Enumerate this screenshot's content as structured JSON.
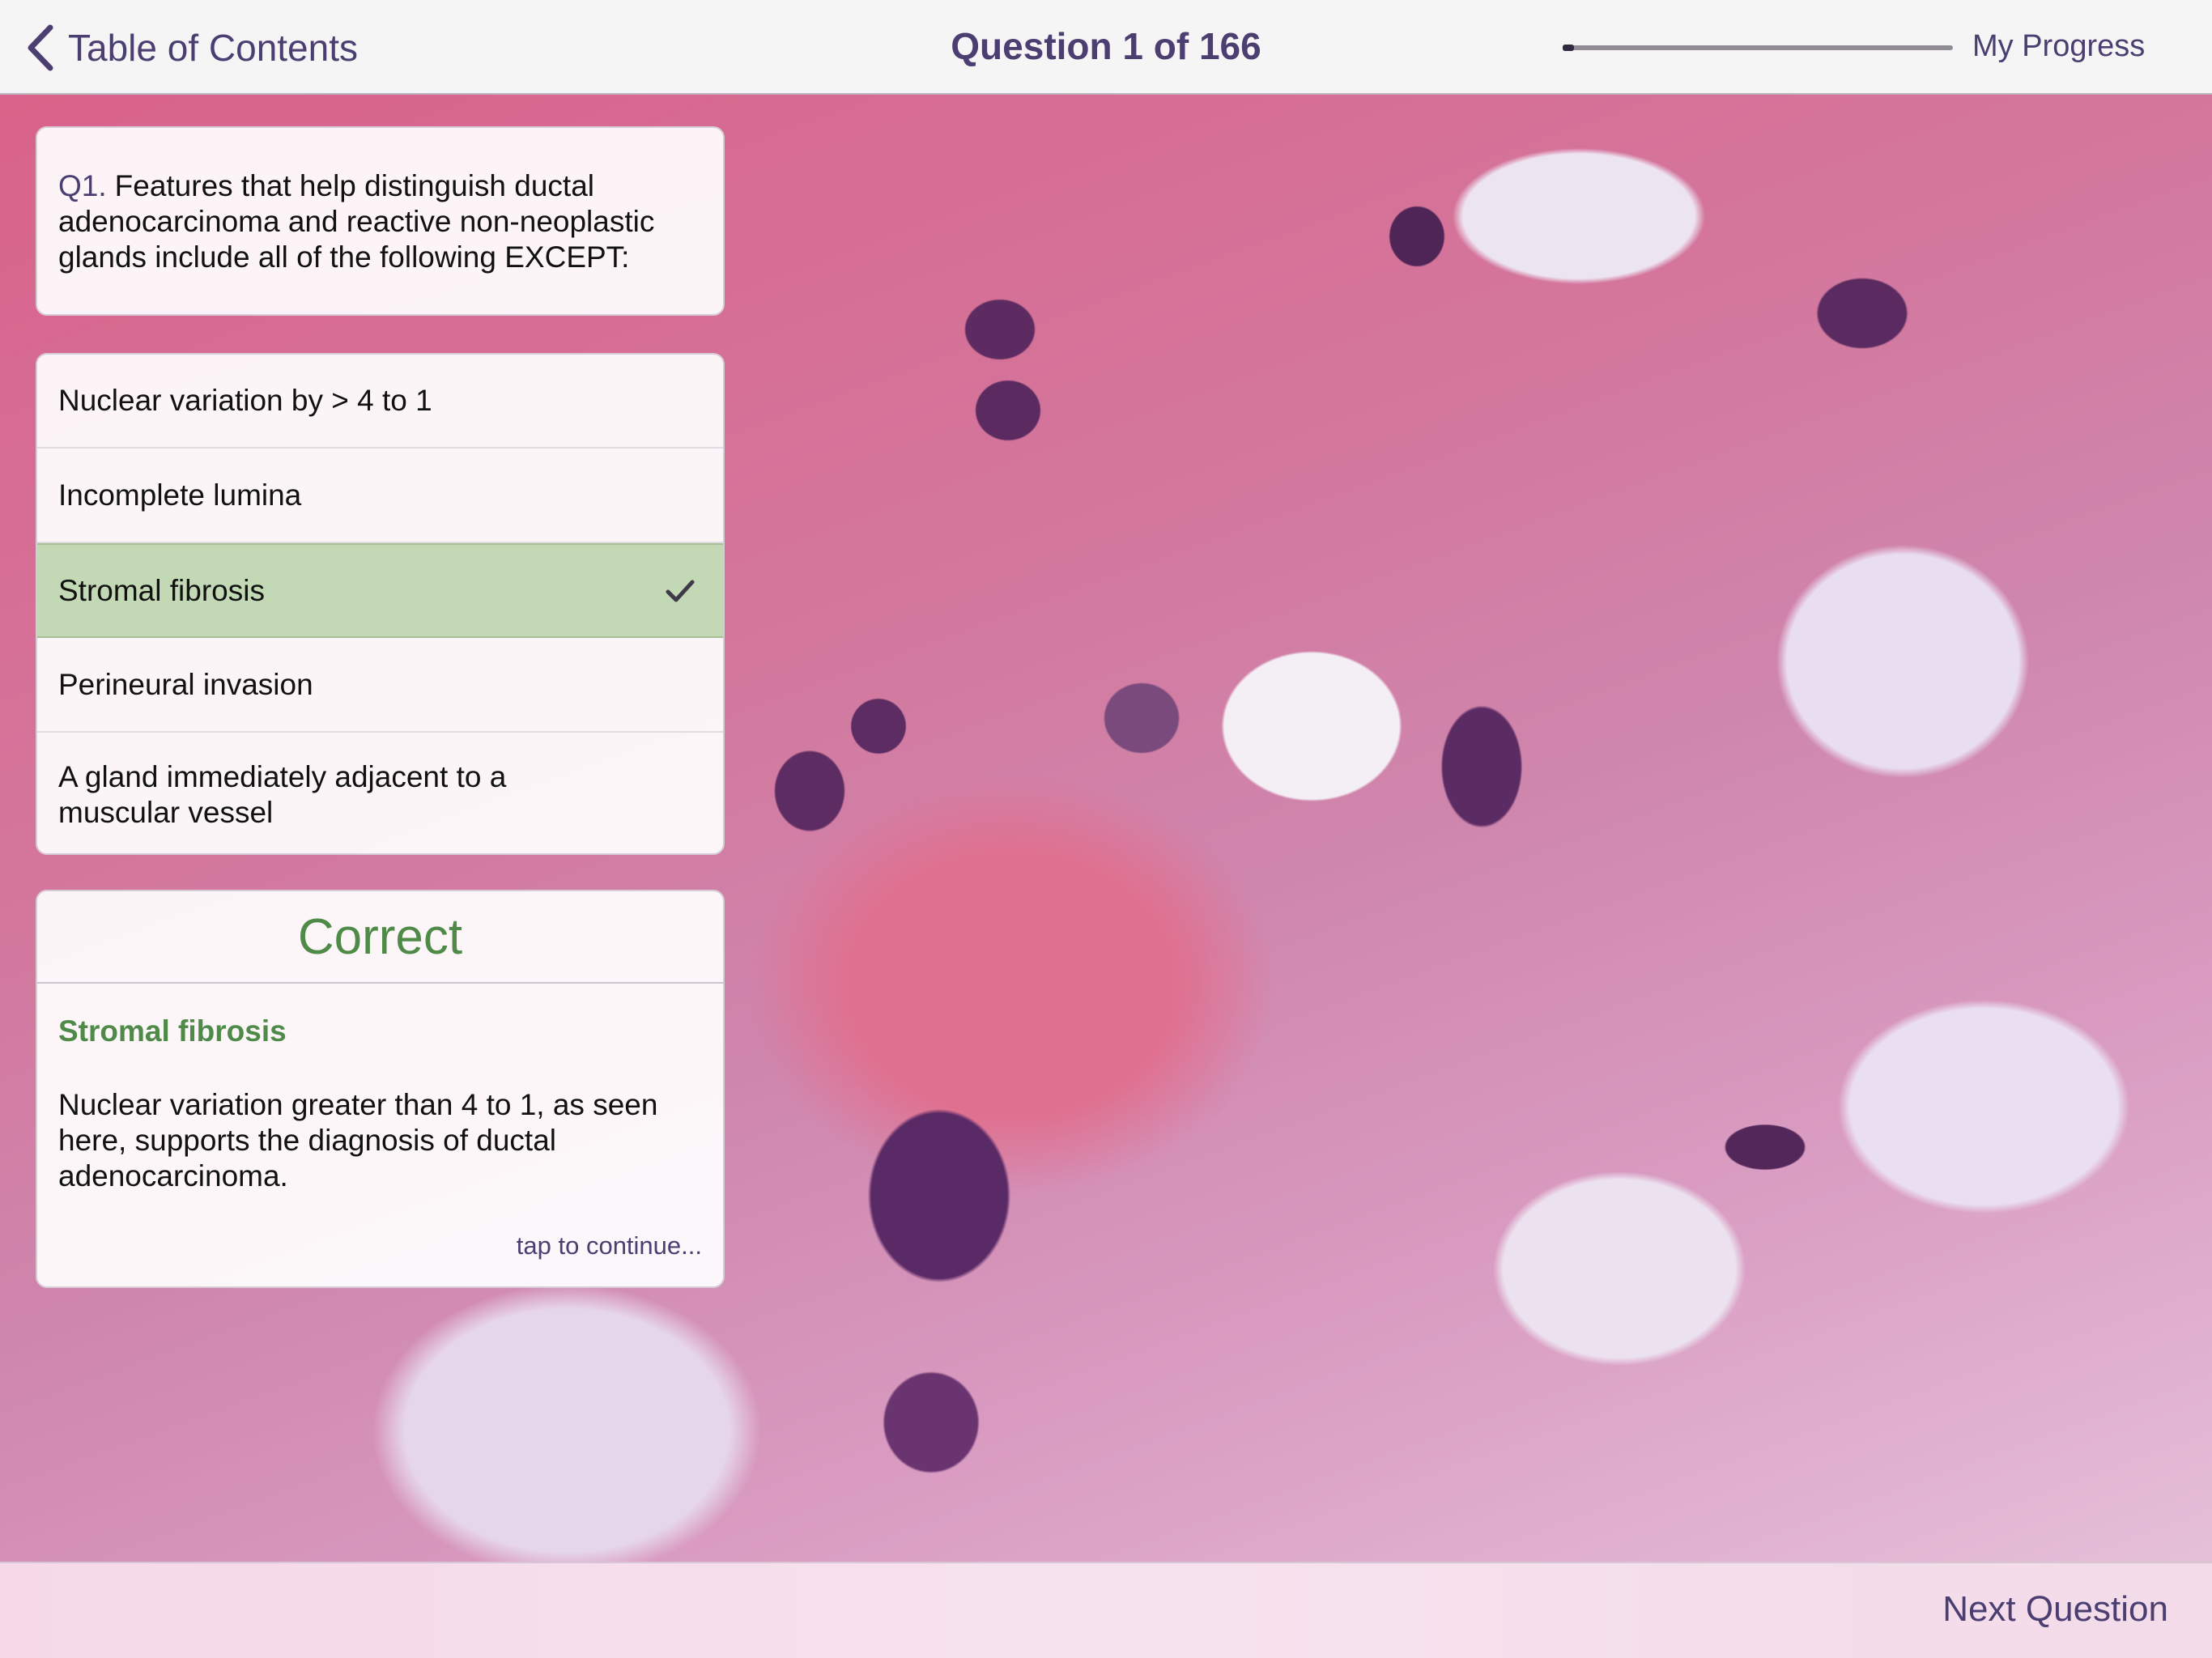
{
  "nav": {
    "back_label": "Table of Contents",
    "title": "Question 1 of 166",
    "progress_label": "My Progress",
    "progress_fraction": 0.03
  },
  "question": {
    "number": "Q1.",
    "text": "Features that help distinguish ductal adenocarcinoma and reactive non-neoplastic glands include all of the following EXCEPT:"
  },
  "answers": [
    {
      "label": "Nuclear variation by > 4 to 1",
      "selected": false
    },
    {
      "label": "Incomplete lumina",
      "selected": false
    },
    {
      "label": "Stromal fibrosis",
      "selected": true
    },
    {
      "label": "Perineural invasion",
      "selected": false
    },
    {
      "label": "A gland immediately adjacent to a muscular vessel",
      "selected": false
    }
  ],
  "result": {
    "status": "Correct",
    "answer": "Stromal fibrosis",
    "explanation": "Nuclear variation greater than 4 to 1, as seen here, supports the diagnosis of ductal adenocarcinoma.",
    "continue_hint": "tap to continue..."
  },
  "footer": {
    "next_label": "Next Question"
  },
  "colors": {
    "accent": "#4b3f72",
    "correct": "#4f8a48",
    "selected_bg": "#c3d8b5"
  },
  "icons": {
    "back": "chevron-left-icon",
    "selected": "checkmark-icon"
  }
}
